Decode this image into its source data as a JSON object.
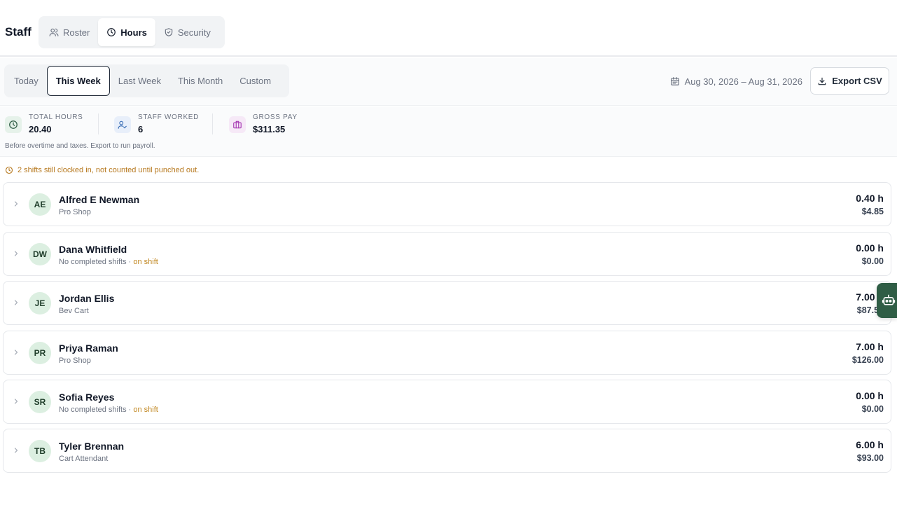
{
  "header": {
    "title": "Staff",
    "tabs": [
      {
        "label": "Roster",
        "icon": "users-icon"
      },
      {
        "label": "Hours",
        "icon": "clock-icon"
      },
      {
        "label": "Security",
        "icon": "shield-icon"
      }
    ],
    "active_tab": "Hours"
  },
  "toolbar": {
    "ranges": [
      "Today",
      "This Week",
      "Last Week",
      "This Month",
      "Custom"
    ],
    "active_range": "This Week",
    "date_range": "Aug 30, 2026 – Aug 31, 2026",
    "export_label": "Export CSV"
  },
  "stats": {
    "total_hours": {
      "label": "TOTAL HOURS",
      "value": "20.40"
    },
    "staff_worked": {
      "label": "STAFF WORKED",
      "value": "6"
    },
    "gross_pay": {
      "label": "GROSS PAY",
      "value": "$311.35"
    },
    "note": "Before overtime and taxes. Export to run payroll."
  },
  "warning": "2 shifts still clocked in, not counted until punched out.",
  "staff": [
    {
      "initials": "AE",
      "name": "Alfred E Newman",
      "sub": "Pro Shop",
      "on_shift": "",
      "hours": "0.40 h",
      "pay": "$4.85"
    },
    {
      "initials": "DW",
      "name": "Dana Whitfield",
      "sub": "No completed shifts · ",
      "on_shift": "on shift",
      "hours": "0.00 h",
      "pay": "$0.00"
    },
    {
      "initials": "JE",
      "name": "Jordan Ellis",
      "sub": "Bev Cart",
      "on_shift": "",
      "hours": "7.00 h",
      "pay": "$87.50"
    },
    {
      "initials": "PR",
      "name": "Priya Raman",
      "sub": "Pro Shop",
      "on_shift": "",
      "hours": "7.00 h",
      "pay": "$126.00"
    },
    {
      "initials": "SR",
      "name": "Sofia Reyes",
      "sub": "No completed shifts · ",
      "on_shift": "on shift",
      "hours": "0.00 h",
      "pay": "$0.00"
    },
    {
      "initials": "TB",
      "name": "Tyler Brennan",
      "sub": "Cart Attendant",
      "on_shift": "",
      "hours": "6.00 h",
      "pay": "$93.00"
    }
  ],
  "colors": {
    "accent_green": "#2f5d45",
    "avatar_bg": "#dcefe1",
    "warning": "#b7791f",
    "on_shift": "#c0851d"
  }
}
